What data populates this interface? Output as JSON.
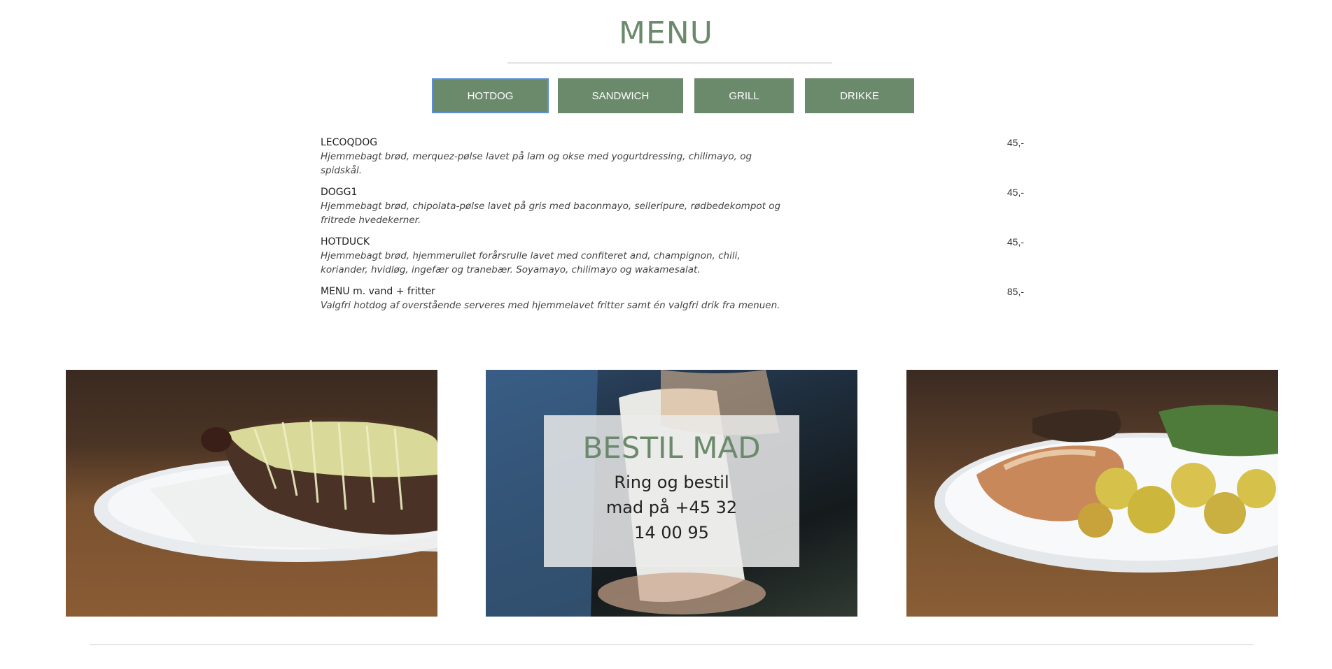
{
  "menu": {
    "title": "MENU",
    "tabs": [
      {
        "label": "HOTDOG",
        "active": true
      },
      {
        "label": "SANDWICH",
        "active": false
      },
      {
        "label": "GRILL",
        "active": false
      },
      {
        "label": "DRIKKE",
        "active": false
      }
    ],
    "items": [
      {
        "name": "LECOQDOG",
        "description": "Hjemmebagt brød, merquez-pølse lavet på lam og okse med yogurtdressing, chilimayo, og spidskål.",
        "price": "45,-"
      },
      {
        "name": "DOGG1",
        "description": "Hjemmebagt brød, chipolata-pølse lavet på gris med baconmayo, selleripure, rødbedekompot og fritrede hvedekerner.",
        "price": "45,-"
      },
      {
        "name": "HOTDUCK",
        "description": "Hjemmebagt brød, hjemmerullet forårsrulle lavet med confiteret and, champignon, chili, koriander, hvidløg, ingefær og tranebær. Soyamayo, chilimayo og wakamesalat.",
        "price": "45,-"
      },
      {
        "name": "MENU m. vand + fritter",
        "description": "Valgfri hotdog af overstående serveres med hjemmelavet fritter samt én valgfri drik fra menuen.",
        "price": "85,-"
      }
    ]
  },
  "promo": {
    "title": "BESTIL MAD",
    "text": "Ring og bestil mad på +45 32 14 00 95"
  },
  "colors": {
    "accent": "#6b8a6b",
    "active_tab_border": "#5b8fd6"
  }
}
